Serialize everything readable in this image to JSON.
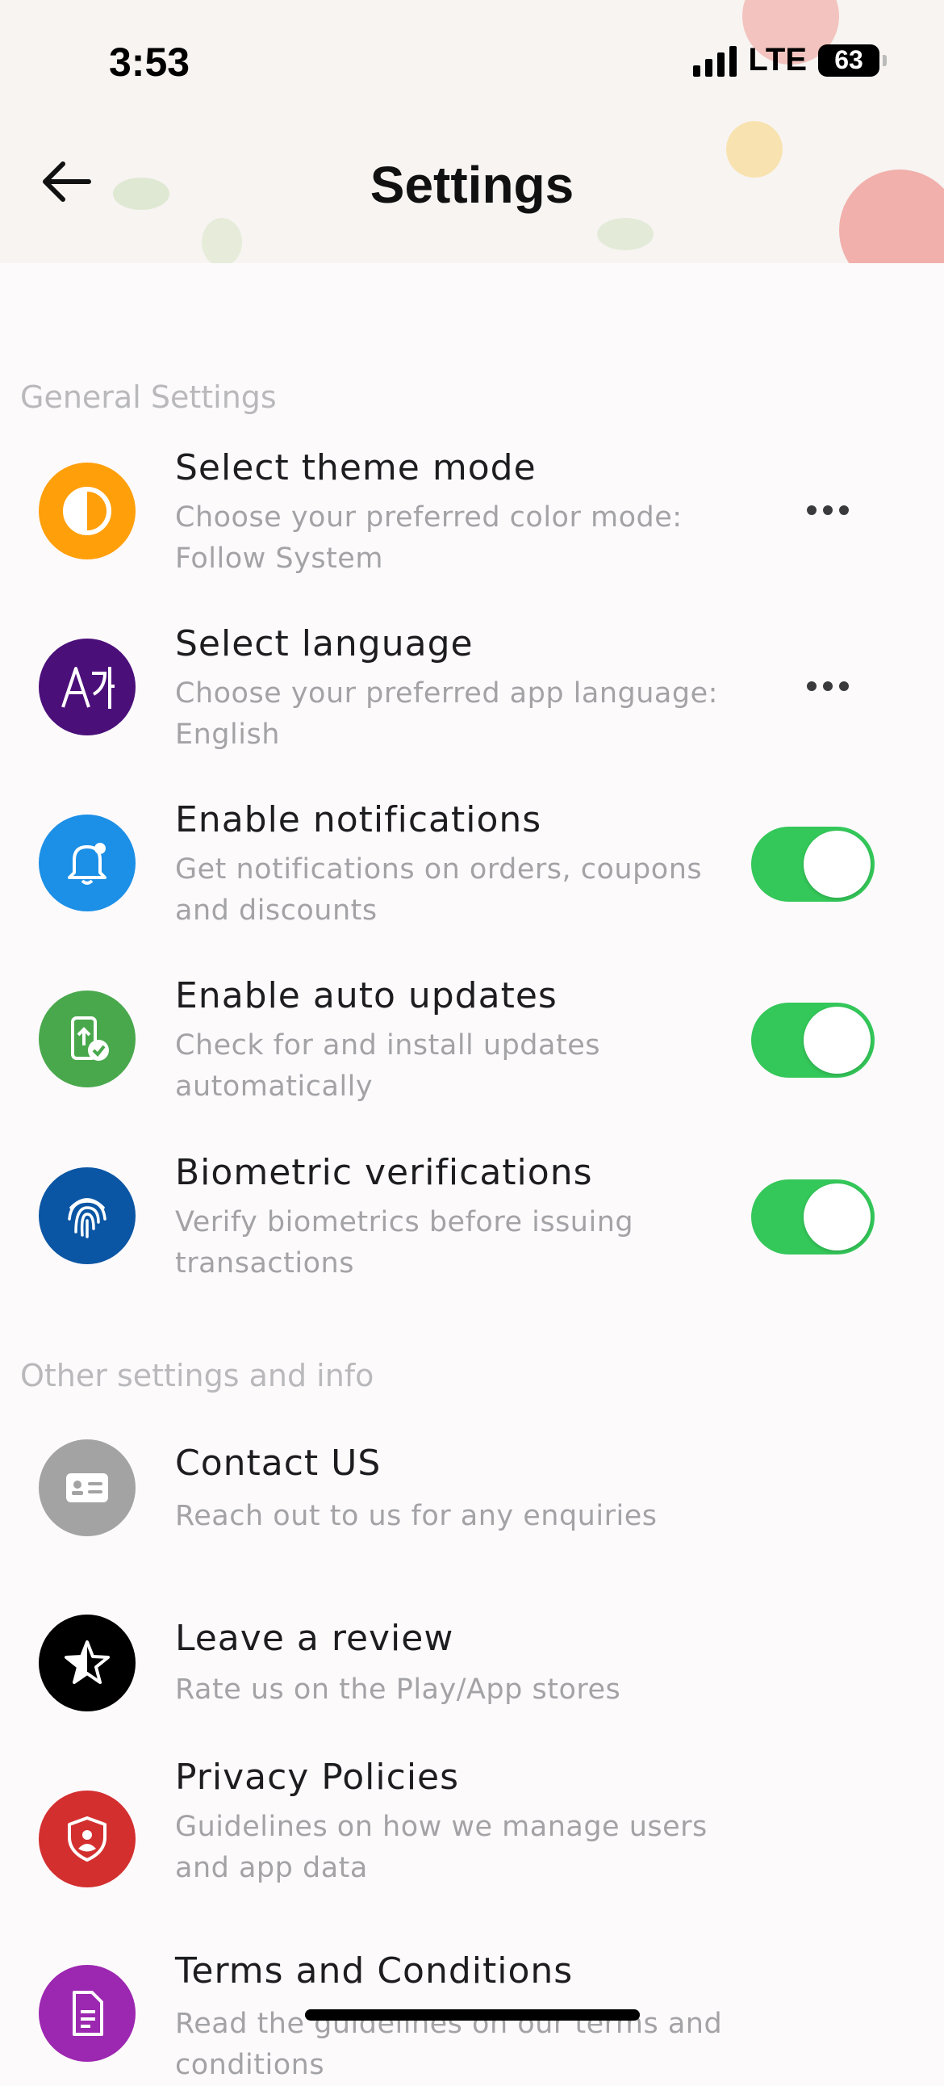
{
  "status_bar": {
    "time": "3:53",
    "network": "LTE",
    "battery": "63"
  },
  "header": {
    "title": "Settings",
    "back_icon": "arrow-left-icon"
  },
  "sections": {
    "general": "General Settings",
    "other": "Other settings and info"
  },
  "general_items": [
    {
      "title": "Select theme mode",
      "subtitle": "Choose your preferred color mode: Follow System",
      "icon": "half-circle-icon",
      "icon_color": "#ff9f0a",
      "control": "more"
    },
    {
      "title": "Select language",
      "subtitle": "Choose your preferred app language: English",
      "icon": "translate-icon",
      "icon_color": "#4b0f7a",
      "control": "more"
    },
    {
      "title": "Enable notifications",
      "subtitle": "Get notifications on orders, coupons and discounts",
      "icon": "bell-icon",
      "icon_color": "#1c8fe6",
      "control": "toggle",
      "on": true
    },
    {
      "title": "Enable auto updates",
      "subtitle": "Check for and install updates automatically",
      "icon": "phone-update-icon",
      "icon_color": "#49a84c",
      "control": "toggle",
      "on": true
    },
    {
      "title": "Biometric verifications",
      "subtitle": "Verify biometrics before issuing transactions",
      "icon": "fingerprint-icon",
      "icon_color": "#0b56a4",
      "control": "toggle",
      "on": true
    }
  ],
  "other_items": [
    {
      "title": "Contact US",
      "subtitle": "Reach out to us for any enquiries",
      "icon": "contact-card-icon",
      "icon_color": "#a3a3a3"
    },
    {
      "title": "Leave a review",
      "subtitle": "Rate us on the Play/App stores",
      "icon": "star-review-icon",
      "icon_color": "#000000"
    },
    {
      "title": "Privacy Policies",
      "subtitle": "Guidelines on how we manage users and app data",
      "icon": "shield-user-icon",
      "icon_color": "#d32f2f"
    },
    {
      "title": "Terms and Conditions",
      "subtitle": "Read the guidelines on our terms and conditions",
      "icon": "document-icon",
      "icon_color": "#9c27b0"
    }
  ],
  "colors": {
    "toggle_on": "#34c759",
    "background": "#fdfafc"
  }
}
